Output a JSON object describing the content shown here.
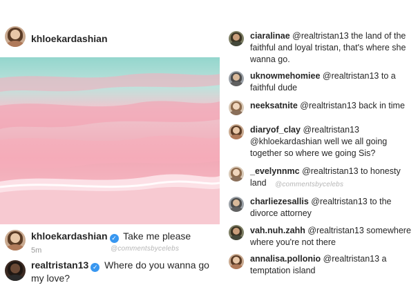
{
  "post": {
    "header_username": "khloekardashian",
    "caption": {
      "username": "khloekardashian",
      "text": "Take me please",
      "time": "5m",
      "watermark": "@commentsbycelebs"
    },
    "reply": {
      "username": "realtristan13",
      "text": "Where do you wanna go my love?"
    }
  },
  "comments": [
    {
      "username": "ciaralinae",
      "text": "@realtristan13 the land of the faithful and loyal tristan, that's where she wanna go."
    },
    {
      "username": "uknowmehomiee",
      "text": "@realtristan13 to a faithful dude"
    },
    {
      "username": "neeksatnite",
      "text": "@realtristan13 back in time"
    },
    {
      "username": "diaryof_clay",
      "text": "@realtristan13 @khloekardashian well we all going together so where we going Sis?"
    },
    {
      "username": "_evelynnmc",
      "text": "@realtristan13 to honesty land",
      "watermark": "@commentsbycelebs"
    },
    {
      "username": "charliezesallis",
      "text": "@realtristan13 to the divorce attorney"
    },
    {
      "username": "vah.nuh.zahh",
      "text": "@realtristan13 somewhere where you're not there"
    },
    {
      "username": "annalisa.pollonio",
      "text": "@realtristan13 a temptation island"
    }
  ],
  "colors": {
    "verified_badge": "#3897f0",
    "sea_teal": "#8fd3c9",
    "sand_pink": "#f4b8c4"
  }
}
